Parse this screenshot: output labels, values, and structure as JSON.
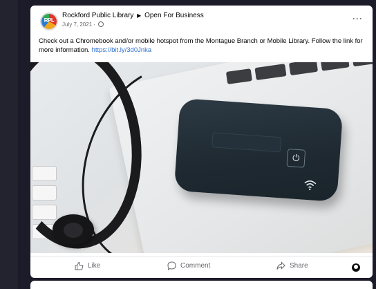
{
  "post": {
    "page_name": "Rockford Public Library",
    "separator": "▶",
    "group_name": "Open For Business",
    "date": "July 7, 2021 ·",
    "avatar_text": "RPL",
    "more_label": "···",
    "text": "Check out a Chromebook and/or mobile hotspot from the Montague Branch or Mobile Library. Follow the link for more information.",
    "link": "https://bit.ly/3d0Jnka"
  },
  "actions": {
    "like": "Like",
    "comment": "Comment",
    "share": "Share"
  },
  "icons": {
    "like": "thumbs-up-icon",
    "comment": "comment-bubble-icon",
    "share": "share-arrow-icon",
    "audience": "globe-icon",
    "more": "ellipsis-icon"
  }
}
